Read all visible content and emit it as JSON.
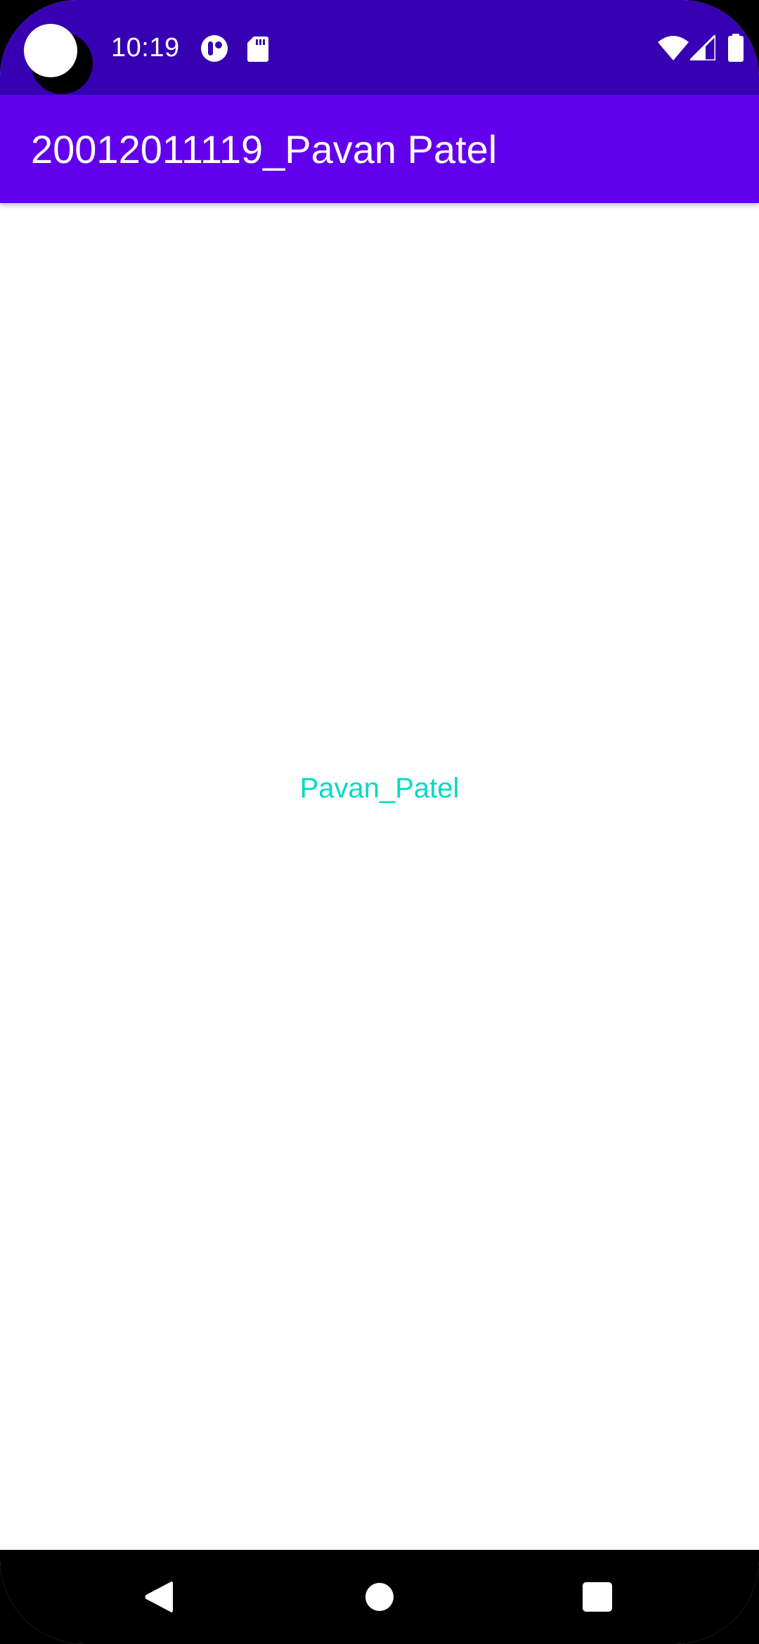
{
  "theme": {
    "status_bar_color": "#3700B3",
    "primary_color": "#6200EE",
    "accent_color": "#03DAC5"
  },
  "status_bar": {
    "time": "10:19",
    "icons": [
      "app-notification-icon",
      "sd-card-icon",
      "wifi-icon",
      "cell-signal-icon",
      "battery-icon"
    ]
  },
  "app_bar": {
    "title": "20012011119_Pavan Patel"
  },
  "content": {
    "text": "Pavan_Patel"
  },
  "nav_bar": {
    "buttons": [
      "back-icon",
      "home-icon",
      "recents-icon"
    ]
  }
}
